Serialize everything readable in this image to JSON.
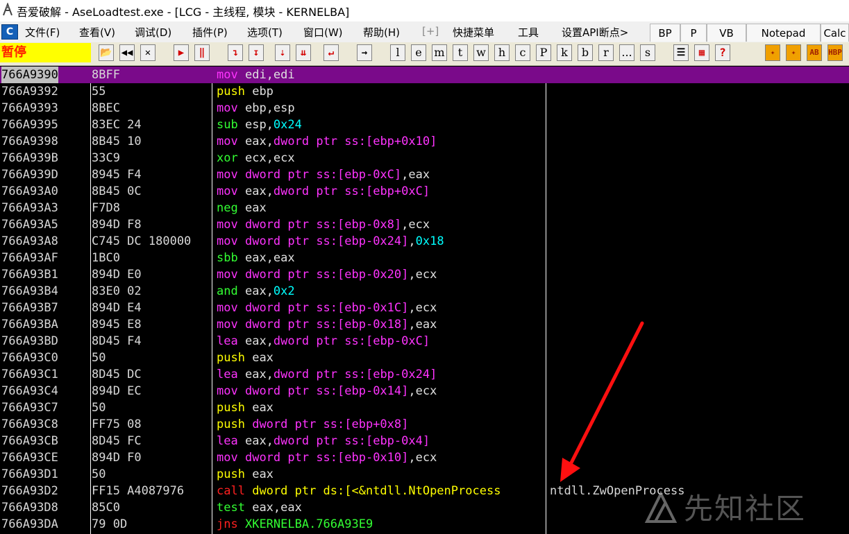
{
  "window": {
    "title": "吾爱破解 - AseLoadtest.exe - [LCG -  主线程, 模块 - KERNELBA]"
  },
  "menu": {
    "logo": "C",
    "items": [
      "文件(F)",
      "查看(V)",
      "调试(D)",
      "插件(P)",
      "选项(T)",
      "窗口(W)",
      "帮助(H)",
      "[+]",
      "快捷菜单",
      "工具",
      "设置API断点>"
    ],
    "plugins": [
      "BP",
      "P",
      "VB",
      "Notepad",
      "Calc"
    ]
  },
  "toolbar": {
    "status": "暂停",
    "letters": [
      "l",
      "e",
      "m",
      "t",
      "w",
      "h",
      "c",
      "P",
      "k",
      "b",
      "r",
      "...",
      "s"
    ],
    "help": "?",
    "hbp": "HBP"
  },
  "disasm": {
    "rows": [
      {
        "addr": "766A9390",
        "hex": "8BFF",
        "mnem": "mov",
        "ops": "edi,edi",
        "selected": true
      },
      {
        "addr": "766A9392",
        "hex": "55",
        "mnem": "push",
        "ops": "ebp"
      },
      {
        "addr": "766A9393",
        "hex": "8BEC",
        "mnem": "mov",
        "ops": "ebp,esp"
      },
      {
        "addr": "766A9395",
        "hex": "83EC 24",
        "mnem": "sub",
        "ops": "esp,",
        "imm": "0x24"
      },
      {
        "addr": "766A9398",
        "hex": "8B45 10",
        "mnem": "mov",
        "ops": "eax,",
        "mem": "dword ptr ss:[ebp+0x10]"
      },
      {
        "addr": "766A939B",
        "hex": "33C9",
        "mnem": "xor",
        "ops": "ecx,ecx"
      },
      {
        "addr": "766A939D",
        "hex": "8945 F4",
        "mnem": "mov",
        "mem": "dword ptr ss:[ebp-0xC]",
        "ops2": ",eax"
      },
      {
        "addr": "766A93A0",
        "hex": "8B45 0C",
        "mnem": "mov",
        "ops": "eax,",
        "mem": "dword ptr ss:[ebp+0xC]"
      },
      {
        "addr": "766A93A3",
        "hex": "F7D8",
        "mnem": "neg",
        "ops": "eax"
      },
      {
        "addr": "766A93A5",
        "hex": "894D F8",
        "mnem": "mov",
        "mem": "dword ptr ss:[ebp-0x8]",
        "ops2": ",ecx"
      },
      {
        "addr": "766A93A8",
        "hex": "C745 DC 180000",
        "mnem": "mov",
        "mem": "dword ptr ss:[ebp-0x24]",
        "ops2": ",",
        "imm": "0x18"
      },
      {
        "addr": "766A93AF",
        "hex": "1BC0",
        "mnem": "sbb",
        "ops": "eax,eax"
      },
      {
        "addr": "766A93B1",
        "hex": "894D E0",
        "mnem": "mov",
        "mem": "dword ptr ss:[ebp-0x20]",
        "ops2": ",ecx"
      },
      {
        "addr": "766A93B4",
        "hex": "83E0 02",
        "mnem": "and",
        "ops": "eax,",
        "imm": "0x2"
      },
      {
        "addr": "766A93B7",
        "hex": "894D E4",
        "mnem": "mov",
        "mem": "dword ptr ss:[ebp-0x1C]",
        "ops2": ",ecx"
      },
      {
        "addr": "766A93BA",
        "hex": "8945 E8",
        "mnem": "mov",
        "mem": "dword ptr ss:[ebp-0x18]",
        "ops2": ",eax"
      },
      {
        "addr": "766A93BD",
        "hex": "8D45 F4",
        "mnem": "lea",
        "ops": "eax,",
        "mem": "dword ptr ss:[ebp-0xC]"
      },
      {
        "addr": "766A93C0",
        "hex": "50",
        "mnem": "push",
        "ops": "eax"
      },
      {
        "addr": "766A93C1",
        "hex": "8D45 DC",
        "mnem": "lea",
        "ops": "eax,",
        "mem": "dword ptr ss:[ebp-0x24]"
      },
      {
        "addr": "766A93C4",
        "hex": "894D EC",
        "mnem": "mov",
        "mem": "dword ptr ss:[ebp-0x14]",
        "ops2": ",ecx"
      },
      {
        "addr": "766A93C7",
        "hex": "50",
        "mnem": "push",
        "ops": "eax"
      },
      {
        "addr": "766A93C8",
        "hex": "FF75 08",
        "mnem": "push",
        "mem": "dword ptr ss:[ebp+0x8]"
      },
      {
        "addr": "766A93CB",
        "hex": "8D45 FC",
        "mnem": "lea",
        "ops": "eax,",
        "mem": "dword ptr ss:[ebp-0x4]"
      },
      {
        "addr": "766A93CE",
        "hex": "894D F0",
        "mnem": "mov",
        "mem": "dword ptr ss:[ebp-0x10]",
        "ops2": ",ecx"
      },
      {
        "addr": "766A93D1",
        "hex": "50",
        "mnem": "push",
        "ops": "eax"
      },
      {
        "addr": "766A93D2",
        "hex": "FF15 A4087976",
        "mnem": "call",
        "call": "dword ptr ds:[<&ntdll.NtOpenProcess",
        "comment": "ntdll.ZwOpenProcess"
      },
      {
        "addr": "766A93D8",
        "hex": "85C0",
        "mnem": "test",
        "ops": "eax,eax"
      },
      {
        "addr": "766A93DA",
        "hex": "79 0D",
        "mnem": "jns",
        "jmp": "XKERNELBA.766A93E9"
      }
    ]
  },
  "watermark": "先知社区",
  "colors": {
    "selection": "#7a0a8a",
    "status_bg": "#ffff00",
    "status_fg": "#ff2200",
    "arrow": "#ff1010"
  }
}
